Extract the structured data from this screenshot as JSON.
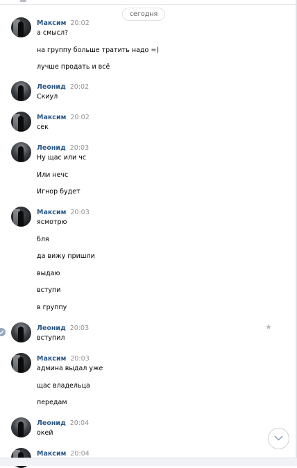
{
  "date_divider": "сегодня",
  "messages": [
    {
      "author": "Максим",
      "time": "20:02",
      "lines": [
        "а смысл?",
        "на группу больше тратить надо =)",
        "лучше продать и всё"
      ]
    },
    {
      "author": "Леонид",
      "time": "20:02",
      "lines": [
        "Скиул"
      ]
    },
    {
      "author": "Максим",
      "time": "20:02",
      "lines": [
        "сек"
      ]
    },
    {
      "author": "Леонид",
      "time": "20:03",
      "lines": [
        "Ну щас или чс",
        "Или нечс",
        "Игнор будет"
      ]
    },
    {
      "author": "Максим",
      "time": "20:03",
      "lines": [
        "ясмотрю",
        "бля",
        "да вижу пришли",
        "выдаю",
        "вступи",
        "в группу"
      ]
    },
    {
      "author": "Леонид",
      "time": "20:03",
      "lines": [
        "вступил"
      ],
      "selected": true,
      "icons": [
        "check-icon",
        "star-icon"
      ]
    },
    {
      "author": "Максим",
      "time": "20:03",
      "lines": [
        "админа выдал уже",
        "щас владельца",
        "передам"
      ]
    },
    {
      "author": "Леонид",
      "time": "20:04",
      "lines": [
        "окей"
      ]
    },
    {
      "author": "Максим",
      "time": "20:04",
      "lines": []
    }
  ],
  "icons": {
    "scroll_down": "chevron-down-icon",
    "star": "star-icon",
    "check": "check-icon"
  },
  "colors": {
    "author_name": "#2a5885",
    "time": "#939393",
    "border": "#dce1e6"
  }
}
